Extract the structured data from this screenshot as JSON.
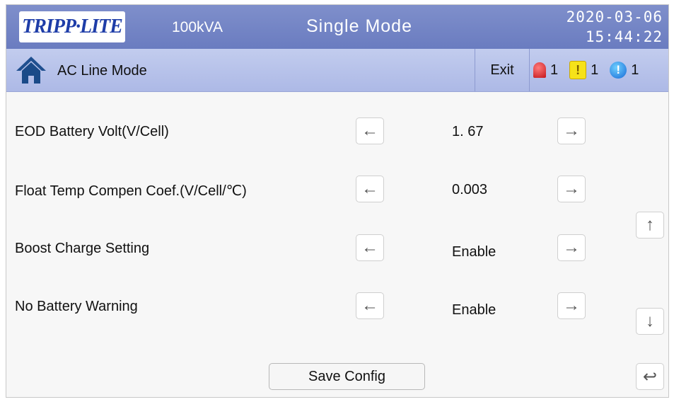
{
  "header": {
    "logo_text": "TRIPP·LITE",
    "capacity": "100kVA",
    "mode": "Single Mode",
    "date": "2020-03-06",
    "time": "15:44:22"
  },
  "subheader": {
    "page_label": "AC Line Mode",
    "exit_label": "Exit",
    "alarms": {
      "critical_count": "1",
      "warning_symbol": "!",
      "warning_count": "1",
      "info_symbol": "!",
      "info_count": "1"
    }
  },
  "settings": [
    {
      "label": "EOD Battery Volt(V/Cell)",
      "value": "1. 67"
    },
    {
      "label": "Float Temp Compen Coef.(V/Cell/℃)",
      "value": "0.003"
    },
    {
      "label": "Boost Charge Setting",
      "value": "Enable"
    },
    {
      "label": "No Battery Warning",
      "value": "Enable"
    }
  ],
  "buttons": {
    "decrease_glyph": "←",
    "increase_glyph": "→",
    "scroll_up_glyph": "↑",
    "scroll_down_glyph": "↓",
    "back_glyph": "↩",
    "save_label": "Save Config"
  },
  "colors": {
    "header_blue": "#7385c4",
    "subheader_blue": "#b5c0ea",
    "logo_blue": "#1e3da8",
    "alarm_red": "#c4161c",
    "alarm_yellow": "#f6e21a",
    "alarm_blue": "#1769d6"
  },
  "icons": {
    "home": "home-icon",
    "critical_alarm": "alarm-bell-icon",
    "warning_alarm": "warning-icon",
    "info_alarm": "info-icon"
  }
}
